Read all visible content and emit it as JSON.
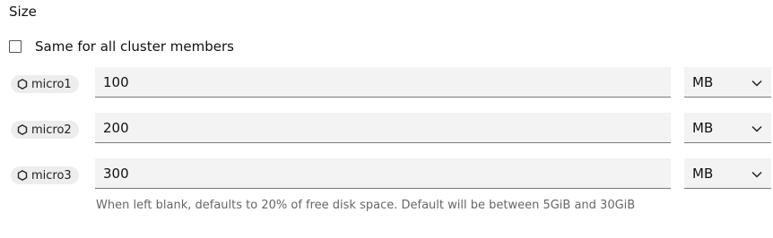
{
  "size_section": {
    "label": "Size",
    "same_for_all": {
      "label": "Same for all cluster members",
      "checked": false
    },
    "members": [
      {
        "name": "micro1",
        "value": "100",
        "unit": "MB",
        "icon": "hexagon-icon"
      },
      {
        "name": "micro2",
        "value": "200",
        "unit": "MB",
        "icon": "hexagon-icon"
      },
      {
        "name": "micro3",
        "value": "300",
        "unit": "MB",
        "icon": "hexagon-icon"
      }
    ],
    "help_text": "When left blank, defaults to 20% of free disk space. Default will be between 5GiB and 30GiB"
  }
}
